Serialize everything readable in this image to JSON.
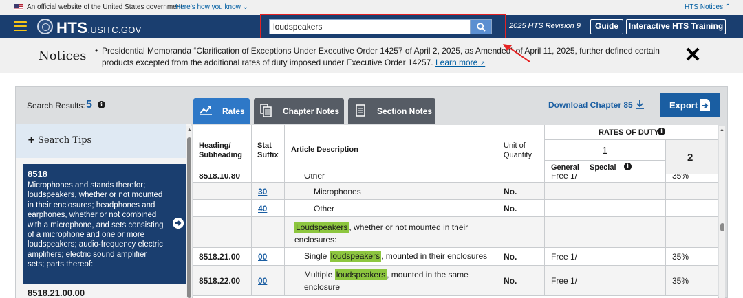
{
  "gov_banner": {
    "official_text": "An official website of the United States government",
    "how_link": "Here’s how you know",
    "hts_notices": "HTS Notices"
  },
  "header": {
    "logo_main": "HTS",
    "logo_suffix": ".USITC.GOV",
    "search_value": "loudspeakers",
    "revision": "2025 HTS Revision 9",
    "guide_label": "Guide",
    "training_label": "Interactive HTS Training"
  },
  "notices": {
    "title": "Notices",
    "text": "Presidential Memoranda “Clarification of Exceptions Under Executive Order 14257 of April 2, 2025, as Amended” of April 11, 2025, further defined certain products excepted from the additional rates of duty imposed under Executive Order 14257.",
    "learn_more": "Learn more"
  },
  "results": {
    "label": "Search Results:",
    "count": "5",
    "tabs": [
      "Rates",
      "Chapter Notes",
      "Section Notes"
    ],
    "download": "Download Chapter 85",
    "export": "Export"
  },
  "sidebar": {
    "search_tips": "Search Tips",
    "heading_num": "8518",
    "heading_desc": "Microphones and stands therefor; loudspeakers, whether or not mounted in their enclosures; headphones and earphones, whether or not combined with a microphone, and sets consisting of a microphone and one or more loudspeakers; audio-frequency electric amplifiers; electric sound amplifier sets; parts thereof:",
    "sub_num": "8518.21.00.00"
  },
  "table": {
    "headers": {
      "heading": "Heading/ Subheading",
      "stat": "Stat Suffix",
      "article": "Article Description",
      "unit": "Unit of Quantity",
      "rates": "RATES OF DUTY",
      "col1": "1",
      "col2": "2",
      "general": "General",
      "special": "Special"
    },
    "partial_row": {
      "heading": "8518.10.80",
      "desc": "Other",
      "general": "Free 1/",
      "col2": "35%"
    },
    "rows": [
      {
        "heading": "",
        "stat": "30",
        "desc": "Microphones",
        "unit": "No.",
        "general": "",
        "col2": ""
      },
      {
        "heading": "",
        "stat": "40",
        "desc": "Other",
        "unit": "No.",
        "general": "",
        "col2": ""
      },
      {
        "heading": "",
        "stat": "",
        "desc_hl": "Loudspeakers",
        "desc_rest": ", whether or not mounted in their enclosures:",
        "unit": "",
        "general": "",
        "col2": ""
      },
      {
        "heading": "8518.21.00",
        "stat": "00",
        "desc_pre": "Single",
        "desc_hl": "loudspeakers",
        "desc_rest": ", mounted in their enclosures",
        "unit": "No.",
        "general": "Free 1/",
        "col2": "35%"
      },
      {
        "heading": "8518.22.00",
        "stat": "00",
        "desc_pre": "Multiple",
        "desc_hl": "loudspeakers",
        "desc_rest": ", mounted in the same enclosure",
        "unit": "No.",
        "general": "Free 1/",
        "col2": "35%"
      }
    ]
  },
  "colors": {
    "header_bg": "#1a3e6f",
    "accent_blue": "#1a5ea2",
    "highlight_green": "#8dc63f",
    "annotation_red": "#e52222",
    "tab_active": "#2e78c7",
    "tab_inactive": "#565c65"
  }
}
